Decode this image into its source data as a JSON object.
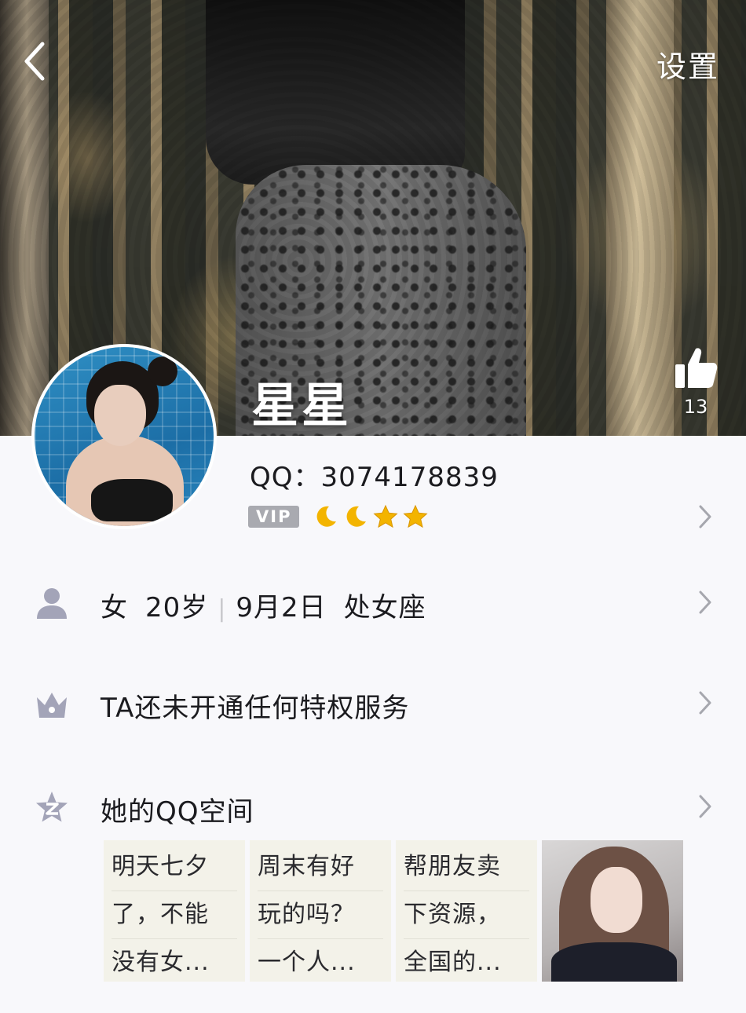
{
  "nav": {
    "back_icon": "chevron-left-icon",
    "settings_label": "设置"
  },
  "profile": {
    "nickname": "星星",
    "likes": "13",
    "qq_label": "QQ：",
    "qq_number": "3074178839",
    "vip_label": "VIP",
    "level_icons": [
      "moon",
      "moon",
      "star",
      "star"
    ]
  },
  "info": {
    "gender": "女",
    "age": "20岁",
    "separator": "|",
    "birthday": "9月2日",
    "zodiac": "处女座"
  },
  "privilege": {
    "text": "TA还未开通任何特权服务"
  },
  "qzone": {
    "title": "她的QQ空间",
    "posts": [
      {
        "lines": [
          "明天七夕",
          "了，不能",
          "没有女..."
        ]
      },
      {
        "lines": [
          "周末有好",
          "玩的吗？",
          "一个人..."
        ]
      },
      {
        "lines": [
          "帮朋友卖",
          "下资源，",
          "全国的..."
        ]
      }
    ]
  },
  "colors": {
    "icon_gray": "#a3a4b8",
    "chevron_gray": "#a6a7ae",
    "level_gold": "#f3b400"
  }
}
